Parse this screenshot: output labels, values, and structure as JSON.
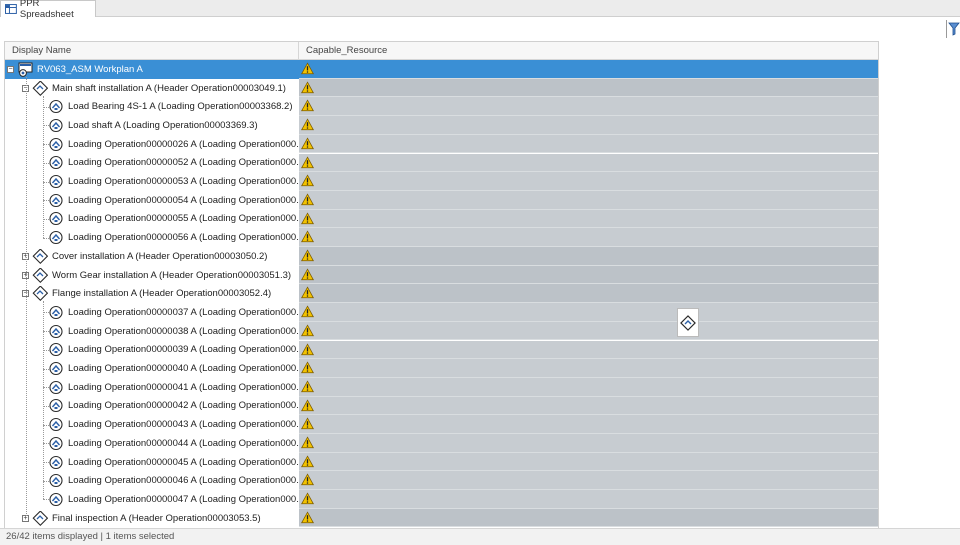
{
  "tab": {
    "label": "PPR Spreadsheet"
  },
  "columns": {
    "display_name": "Display Name",
    "capable_resource": "Capable_Resource"
  },
  "rows": [
    {
      "label": "RV063_ASM Workplan A",
      "level": 0,
      "expander": "-",
      "icon": "workplan-icon",
      "selected": true
    },
    {
      "label": "Main shaft installation A (Header Operation00003049.1)",
      "level": 1,
      "expander": "-",
      "icon": "header-operation-icon"
    },
    {
      "label": "Load Bearing 4S-1 A (Loading Operation00003368.2)",
      "level": 2,
      "icon": "loading-operation-icon"
    },
    {
      "label": "Load shaft A (Loading Operation00003369.3)",
      "level": 2,
      "icon": "loading-operation-icon"
    },
    {
      "label": "Loading Operation00000026 A (Loading Operation000...",
      "level": 2,
      "icon": "loading-operation-icon"
    },
    {
      "label": "Loading Operation00000052 A (Loading Operation000...",
      "level": 2,
      "icon": "loading-operation-icon"
    },
    {
      "label": "Loading Operation00000053 A (Loading Operation000...",
      "level": 2,
      "icon": "loading-operation-icon"
    },
    {
      "label": "Loading Operation00000054 A (Loading Operation000...",
      "level": 2,
      "icon": "loading-operation-icon"
    },
    {
      "label": "Loading Operation00000055 A (Loading Operation000...",
      "level": 2,
      "icon": "loading-operation-icon"
    },
    {
      "label": "Loading Operation00000056 A (Loading Operation000...",
      "level": 2,
      "icon": "loading-operation-icon"
    },
    {
      "label": "Cover installation A (Header Operation00003050.2)",
      "level": 1,
      "expander": "+",
      "icon": "header-operation-icon"
    },
    {
      "label": "Worm Gear installation A (Header Operation00003051.3)",
      "level": 1,
      "expander": "+",
      "icon": "header-operation-icon"
    },
    {
      "label": "Flange installation A (Header Operation00003052.4)",
      "level": 1,
      "expander": "-",
      "icon": "header-operation-icon"
    },
    {
      "label": "Loading Operation00000037 A (Loading Operation000...",
      "level": 2,
      "icon": "loading-operation-icon"
    },
    {
      "label": "Loading Operation00000038 A (Loading Operation000...",
      "level": 2,
      "icon": "loading-operation-icon"
    },
    {
      "label": "Loading Operation00000039 A (Loading Operation000...",
      "level": 2,
      "icon": "loading-operation-icon"
    },
    {
      "label": "Loading Operation00000040 A (Loading Operation000...",
      "level": 2,
      "icon": "loading-operation-icon"
    },
    {
      "label": "Loading Operation00000041 A (Loading Operation000...",
      "level": 2,
      "icon": "loading-operation-icon"
    },
    {
      "label": "Loading Operation00000042 A (Loading Operation000...",
      "level": 2,
      "icon": "loading-operation-icon"
    },
    {
      "label": "Loading Operation00000043 A (Loading Operation000...",
      "level": 2,
      "icon": "loading-operation-icon"
    },
    {
      "label": "Loading Operation00000044 A (Loading Operation000...",
      "level": 2,
      "icon": "loading-operation-icon"
    },
    {
      "label": "Loading Operation00000045 A (Loading Operation000...",
      "level": 2,
      "icon": "loading-operation-icon"
    },
    {
      "label": "Loading Operation00000046 A (Loading Operation000...",
      "level": 2,
      "icon": "loading-operation-icon"
    },
    {
      "label": "Loading Operation00000047 A (Loading Operation000...",
      "level": 2,
      "icon": "loading-operation-icon"
    },
    {
      "label": "Final inspection A (Header Operation00003053.5)",
      "level": 1,
      "expander": "+",
      "icon": "header-operation-icon"
    }
  ],
  "status": {
    "text": "26/42 items displayed | 1 items selected"
  },
  "icons": {
    "warning": "warning-icon",
    "filter": "filter-icon",
    "drag": "drag-operation-icon",
    "tab": "spreadsheet-icon"
  },
  "colors": {
    "selection": "#3a8fd5",
    "resource_cell": "#c7ccd1",
    "warning": "#f2c200"
  }
}
